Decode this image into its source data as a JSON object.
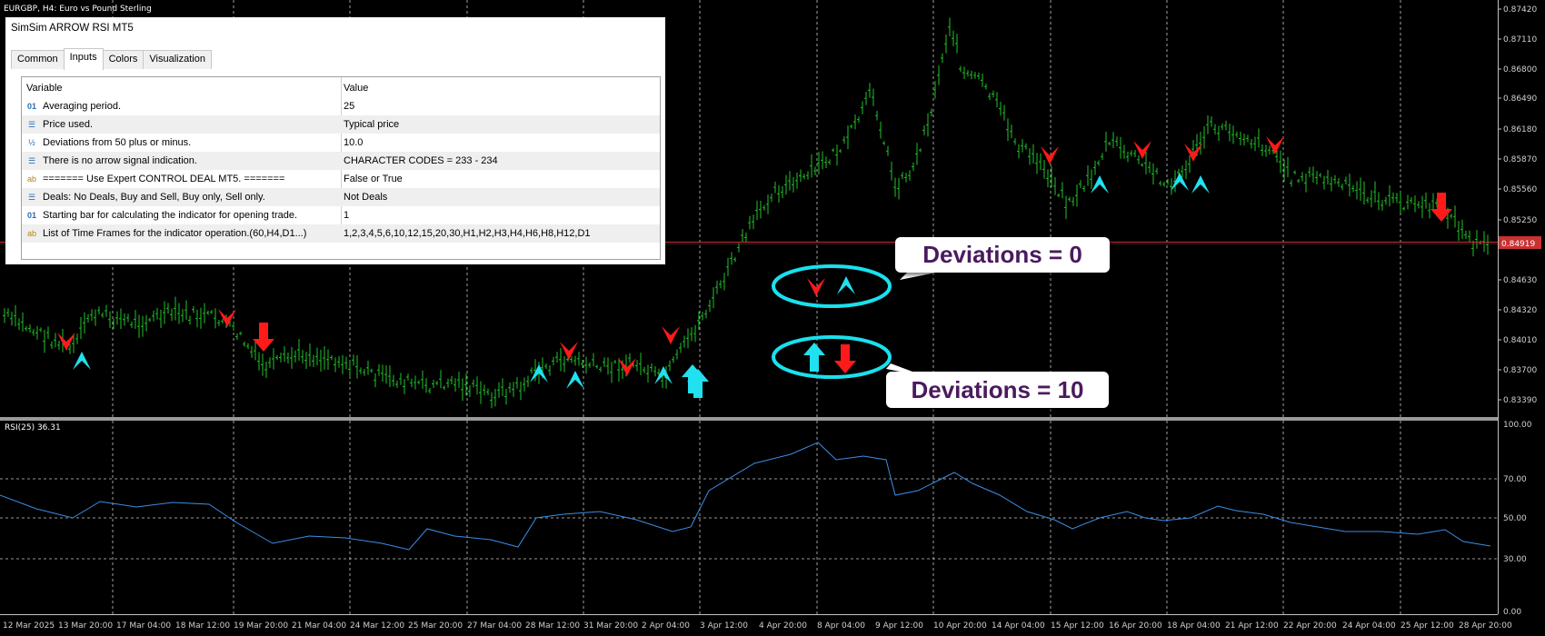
{
  "chart": {
    "symbol_info": "EURGBP, H4:  Euro vs Pound Sterling",
    "price_labels": [
      "0.87420",
      "0.87110",
      "0.86800",
      "0.86490",
      "0.86180",
      "0.85870",
      "0.85560",
      "0.85250",
      "0.84630",
      "0.84320",
      "0.84010",
      "0.83700",
      "0.83390"
    ],
    "current_price": "0.84919",
    "rsi_label": "RSI(25) 36.31",
    "rsi_levels": [
      "100.00",
      "70.00",
      "50.00",
      "30.00",
      "0.00"
    ],
    "time_labels": [
      "12 Mar 2025",
      "13 Mar 20:00",
      "17 Mar 04:00",
      "18 Mar 12:00",
      "19 Mar 20:00",
      "21 Mar 04:00",
      "24 Mar 12:00",
      "25 Mar 20:00",
      "27 Mar 04:00",
      "28 Mar 12:00",
      "31 Mar 20:00",
      "2 Apr 04:00",
      "3 Apr 12:00",
      "4 Apr 20:00",
      "8 Apr 04:00",
      "9 Apr 12:00",
      "10 Apr 20:00",
      "14 Apr 04:00",
      "15 Apr 12:00",
      "16 Apr 20:00",
      "18 Apr 04:00",
      "21 Apr 12:00",
      "22 Apr 20:00",
      "24 Apr 04:00",
      "25 Apr 12:00",
      "28 Apr 20:00"
    ],
    "colors": {
      "candles": "#22c22a",
      "rsi": "#3a8ee6",
      "price_line": "#c83232",
      "arrow_up": "#21e0f0",
      "arrow_down": "#ff1a1a",
      "highlight": "#1ae0ee"
    }
  },
  "dialog": {
    "title": "SimSim ARROW RSI MT5",
    "tabs": [
      "Common",
      "Inputs",
      "Colors",
      "Visualization"
    ],
    "active_tab": "Inputs",
    "headers": {
      "variable": "Variable",
      "value": "Value"
    },
    "rows": [
      {
        "icon": "int-icon",
        "variable": "Averaging period.",
        "value": "25"
      },
      {
        "icon": "list-icon",
        "variable": "Price used.",
        "value": "Typical price"
      },
      {
        "icon": "double-icon",
        "variable": "Deviations from 50 plus or minus.",
        "value": "10.0"
      },
      {
        "icon": "list-icon",
        "variable": "There is no arrow signal indication.",
        "value": "CHARACTER CODES = 233 - 234"
      },
      {
        "icon": "string-icon",
        "variable": "=======     Use Expert CONTROL DEAL MT5.     =======",
        "value": "False or True"
      },
      {
        "icon": "list-icon",
        "variable": "Deals: No Deals, Buy and Sell, Buy only, Sell only.",
        "value": "Not Deals"
      },
      {
        "icon": "int-icon",
        "variable": "Starting bar for calculating the indicator for opening trade.",
        "value": "1"
      },
      {
        "icon": "string-icon",
        "variable": "List of Time Frames for the indicator operation.(60,H4,D1...)",
        "value": "1,2,3,4,5,6,10,12,15,20,30,H1,H2,H3,H4,H6,H8,H12,D1"
      }
    ]
  },
  "annotations": {
    "callout_top": "Deviations = 0",
    "callout_bottom": "Deviations = 10"
  }
}
